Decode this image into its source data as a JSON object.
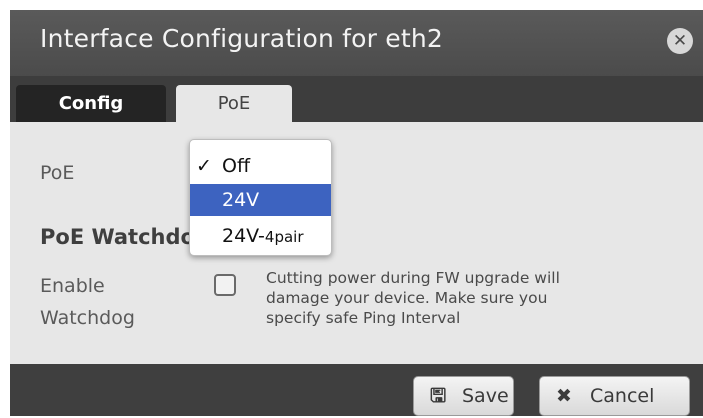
{
  "dialog": {
    "title": "Interface Configuration for eth2",
    "close_icon": "close-icon"
  },
  "tabs": [
    {
      "label": "Config",
      "active": false
    },
    {
      "label": "PoE",
      "active": true
    }
  ],
  "form": {
    "poe_label": "PoE",
    "poe_select": {
      "selected": "Off",
      "highlighted": "24V",
      "options": [
        {
          "label": "Off",
          "checked": true
        },
        {
          "label": "24V",
          "checked": false
        },
        {
          "label_main": "24V-",
          "label_small": "4pair",
          "checked": false
        }
      ]
    },
    "watchdog_heading": "PoE Watchdog",
    "enable_label_line1": "Enable",
    "enable_label_line2": "Watchdog",
    "enable_checked": false,
    "warning_line1": "Cutting power during FW upgrade will",
    "warning_line2": "damage your device. Make sure you",
    "warning_line3": "specify safe Ping Interval"
  },
  "footer": {
    "save_label": "Save",
    "save_icon": "save-icon",
    "cancel_label": "Cancel",
    "cancel_icon": "cancel-icon"
  }
}
